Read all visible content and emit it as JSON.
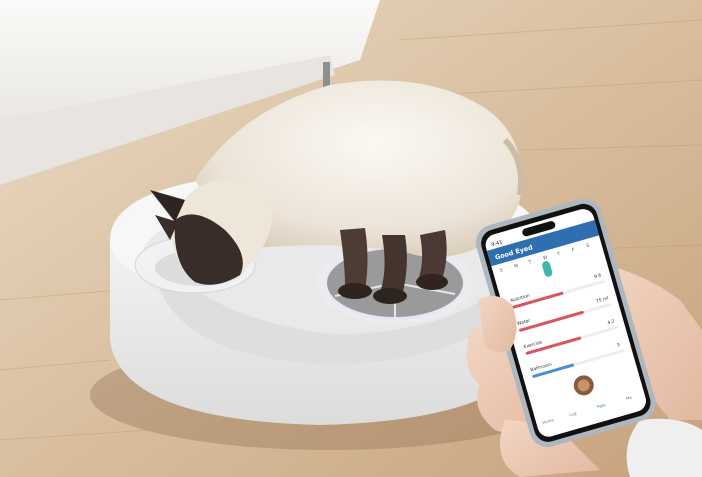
{
  "scene": {
    "description_name": "cat-smart-feeder-photo",
    "colors": {
      "floor_light": "#e8d8c2",
      "floor_dark": "#c9a783",
      "sofa": "#f4f2ef",
      "feeder_body": "#f3f3f3",
      "feeder_ring_glow": "#c9c4f5",
      "cat_fur": "#f1ece4",
      "cat_points": "#3b2e2a",
      "phone_frame": "#b8c0c8",
      "app_accent": "#2f6fb1",
      "bar_red": "#d9545e",
      "bar_blue": "#4c8fd6",
      "bar_teal": "#3fb7b0"
    }
  },
  "phone_app": {
    "header_title": "Good Eyed",
    "status_time": "9:41",
    "calendar_days": [
      "S",
      "M",
      "T",
      "W",
      "T",
      "F",
      "S"
    ],
    "rows": [
      {
        "label": "Nutrition",
        "value": "9.6"
      },
      {
        "label": "Water",
        "value": "75 ml"
      },
      {
        "label": "Exercise",
        "value": "4.2"
      },
      {
        "label": "Bathroom",
        "value": "3"
      }
    ],
    "row_fill": [
      0.55,
      0.7,
      0.6,
      0.45
    ],
    "nav_items": [
      "Home",
      "Log",
      "Pets",
      "Me"
    ]
  }
}
